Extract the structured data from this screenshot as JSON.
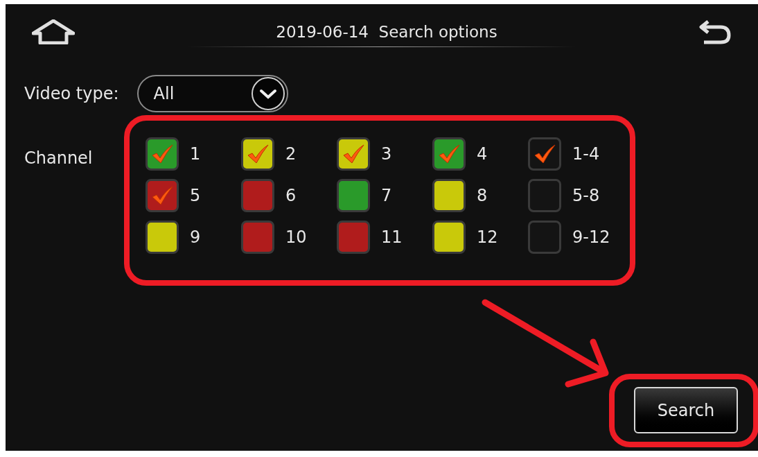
{
  "header": {
    "title": "2019-06-14  Search options"
  },
  "video_type": {
    "label": "Video type:",
    "value": "All"
  },
  "channel": {
    "label": "Channel"
  },
  "channels": [
    {
      "label": "1",
      "color": "#2a9a2a",
      "checked": true
    },
    {
      "label": "2",
      "color": "#c9c90a",
      "checked": true
    },
    {
      "label": "3",
      "color": "#c9c90a",
      "checked": true
    },
    {
      "label": "4",
      "color": "#2a9a2a",
      "checked": true
    },
    {
      "label": "5",
      "color": "#b01c1c",
      "checked": true
    },
    {
      "label": "6",
      "color": "#b01c1c",
      "checked": false
    },
    {
      "label": "7",
      "color": "#2a9a2a",
      "checked": false
    },
    {
      "label": "8",
      "color": "#c9c90a",
      "checked": false
    },
    {
      "label": "9",
      "color": "#c9c90a",
      "checked": false
    },
    {
      "label": "10",
      "color": "#b01c1c",
      "checked": false
    },
    {
      "label": "11",
      "color": "#b01c1c",
      "checked": false
    },
    {
      "label": "12",
      "color": "#c9c90a",
      "checked": false
    }
  ],
  "groups": [
    {
      "label": "1-4",
      "checked": true
    },
    {
      "label": "5-8",
      "checked": false
    },
    {
      "label": "9-12",
      "checked": false
    }
  ],
  "search_button": {
    "label": "Search"
  }
}
